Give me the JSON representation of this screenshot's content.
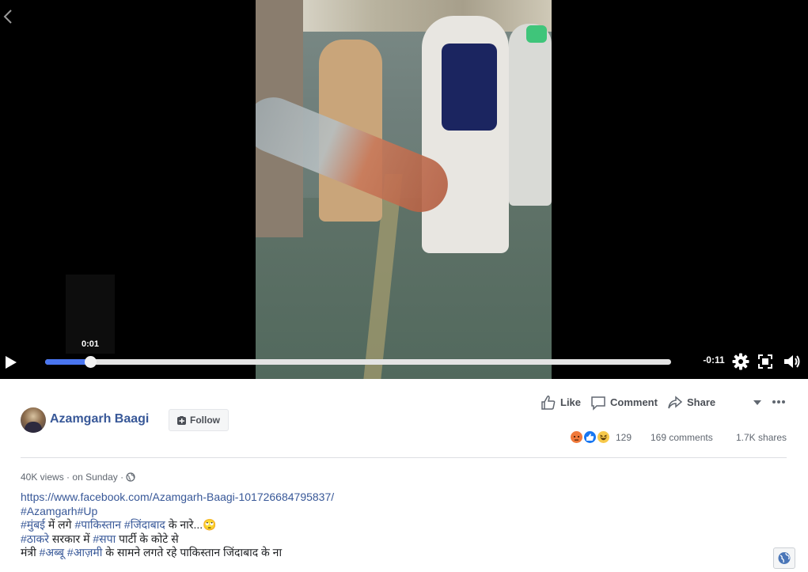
{
  "video": {
    "tooltip_time": "0:01",
    "progress_fraction": 0.072,
    "remaining_time": "-0:11"
  },
  "post": {
    "page_name": "Azamgarh Baagi",
    "follow_label": "Follow",
    "actions": {
      "like": "Like",
      "comment": "Comment",
      "share": "Share"
    },
    "reactions": [
      "angry",
      "like",
      "haha"
    ],
    "reaction_count": "129",
    "comments": "169 comments",
    "shares": "1.7K shares",
    "views": "40K views",
    "time": "on Sunday",
    "description": {
      "url": "https://www.facebook.com/Azamgarh-Baagi-101726684795837/",
      "line2_tags": [
        "#Azamgarh",
        "#Up"
      ],
      "line3": [
        {
          "t": "#मुंबई",
          "link": true
        },
        {
          "t": " में लगे ",
          "link": false
        },
        {
          "t": "#पाकिस्तान",
          "link": true
        },
        {
          "t": " ",
          "link": false
        },
        {
          "t": "#जिंदाबाद",
          "link": true
        },
        {
          "t": " के नारे...",
          "link": false
        }
      ],
      "line3_emoji": "🙄",
      "line4": [
        {
          "t": "#ठाकरे",
          "link": true
        },
        {
          "t": " सरकार में ",
          "link": false
        },
        {
          "t": "#सपा",
          "link": true
        },
        {
          "t": " पार्टी के कोटे से",
          "link": false
        }
      ],
      "line5": [
        {
          "t": "मंत्री ",
          "link": false
        },
        {
          "t": "#अब्बू",
          "link": true
        },
        {
          "t": " ",
          "link": false
        },
        {
          "t": "#आज़मी",
          "link": true
        },
        {
          "t": " के सामने लगते रहे पाकिस्तान जिंदाबाद के ना",
          "link": false
        }
      ]
    }
  },
  "colors": {
    "link": "#385898",
    "progress": "#4a76f0",
    "angry": "#f0793a",
    "like": "#1877f2",
    "haha": "#f7c94b"
  },
  "icons": [
    "back-icon",
    "play-icon",
    "settings-icon",
    "fullscreen-icon",
    "volume-icon",
    "thumbs-up-icon",
    "comment-icon",
    "share-icon",
    "globe-icon"
  ]
}
